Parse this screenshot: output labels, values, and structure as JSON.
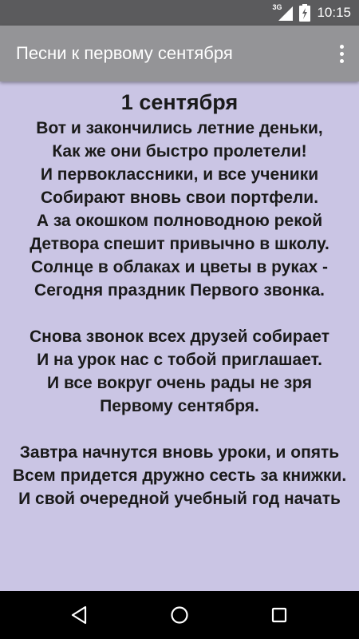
{
  "status_bar": {
    "network": "3G",
    "time": "10:15",
    "icons": [
      "signal-icon",
      "battery-icon"
    ]
  },
  "app_bar": {
    "title": "Песни к первому сентября",
    "menu_icon": "more-vert-icon"
  },
  "song": {
    "title": "1 сентября",
    "stanzas": [
      [
        "Вот и закончились летние деньки,",
        "Как же они быстро пролетели!",
        "И первоклассники, и все ученики",
        "Собирают вновь свои портфели.",
        "А за окошком полноводною рекой",
        "Детвора спешит привычно в школу.",
        "Солнце в облаках и цветы в руках -",
        "Сегодня праздник Первого звонка."
      ],
      [
        "Снова звонок всех друзей собирает",
        "И на урок нас с тобой приглашает.",
        "И все вокруг очень рады не зря",
        "Первому сентября."
      ],
      [
        "Завтра начнутся вновь уроки, и опять",
        "Всем придется дружно сесть за книжки.",
        "И свой очередной учебный год начать"
      ]
    ]
  },
  "nav_bar": {
    "buttons": [
      "back-icon",
      "home-icon",
      "recents-icon"
    ]
  },
  "colors": {
    "background": "#cac5e4",
    "app_bar": "#949497",
    "status_bar": "#5b5b5d",
    "text": "#1a1a1a"
  }
}
